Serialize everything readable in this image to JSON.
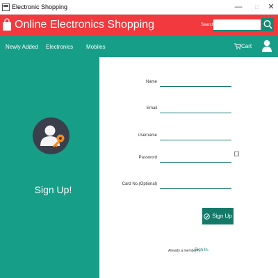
{
  "window": {
    "title": "Electronic Shopping",
    "controls": {
      "minimize": "—",
      "maximize": "□",
      "close": "✕"
    }
  },
  "header": {
    "brand": "Online Electronics Shopping",
    "search_label": "Search",
    "search_value": "",
    "bag_icon": "shopping-bag-icon",
    "search_icon": "search-icon"
  },
  "nav": {
    "items": [
      {
        "label": "Newly Added"
      },
      {
        "label": "Electronics"
      },
      {
        "label": "Mobiles"
      }
    ],
    "cart_label": "Cart",
    "cart_icon": "cart-icon",
    "user_icon": "user-icon"
  },
  "left_panel": {
    "heading": "Sign Up!",
    "avatar_icon": "user-key-icon"
  },
  "form": {
    "fields": [
      {
        "label": "Name",
        "value": ""
      },
      {
        "label": "Email",
        "value": ""
      },
      {
        "label": "Username",
        "value": ""
      },
      {
        "label": "Password",
        "value": ""
      },
      {
        "label": "Card No.(Optional)",
        "value": ""
      }
    ],
    "submit_label": "Sign Up",
    "member_prompt": "Already a member?",
    "signin_label": "Sign In."
  },
  "colors": {
    "header_red": "#f2393d",
    "teal": "#179e88",
    "dark_teal": "#15796a"
  }
}
